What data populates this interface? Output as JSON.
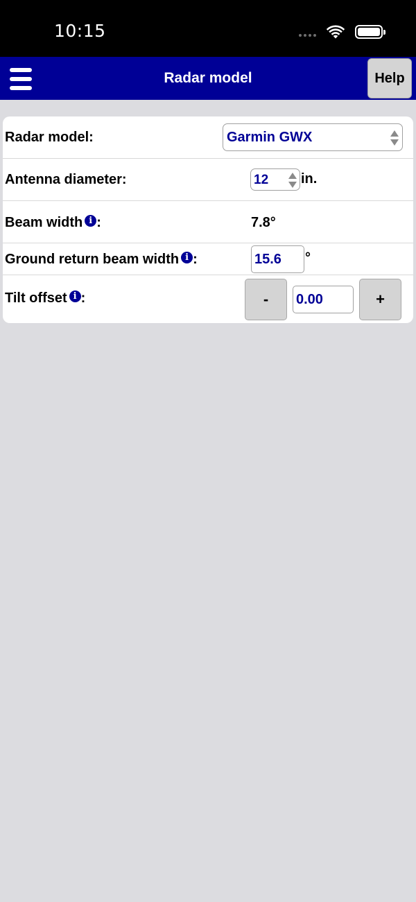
{
  "status_bar": {
    "time": "10:15"
  },
  "nav": {
    "title": "Radar model",
    "help_label": "Help"
  },
  "form": {
    "radar_model": {
      "label": "Radar model:",
      "value": "Garmin GWX"
    },
    "antenna_diameter": {
      "label": "Antenna diameter:",
      "value": "12",
      "unit": "in."
    },
    "beam_width": {
      "label": "Beam width",
      "suffix": ":",
      "value": "7.8°"
    },
    "ground_return": {
      "label": "Ground return beam width",
      "suffix": ":",
      "value": "15.6",
      "unit": "°"
    },
    "tilt_offset": {
      "label": "Tilt offset",
      "suffix": ":",
      "minus_label": "-",
      "value": "0.00",
      "plus_label": "+"
    }
  },
  "icons": {
    "info": "info-icon",
    "menu": "hamburger-menu-icon",
    "wifi": "wifi-icon",
    "battery": "battery-icon",
    "signal": "signal-icon"
  },
  "colors": {
    "nav_bar": "#000096",
    "accent_text": "#000096",
    "background": "#dcdce0"
  }
}
